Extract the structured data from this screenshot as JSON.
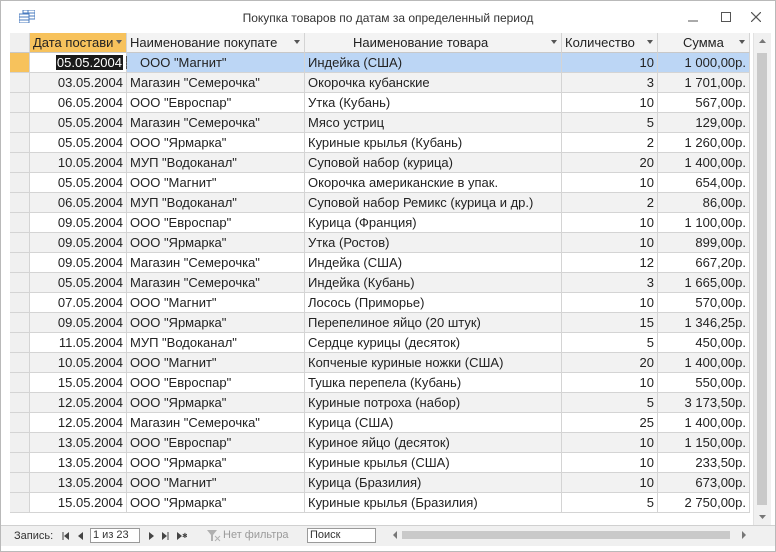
{
  "window": {
    "title": "Покупка товаров по датам за определенный период"
  },
  "columns": [
    {
      "label": "Дата постави",
      "active": true
    },
    {
      "label": "Наименование покупате",
      "active": false
    },
    {
      "label": "Наименование товара",
      "active": false
    },
    {
      "label": "Количество",
      "active": false
    },
    {
      "label": "Сумма",
      "active": false
    }
  ],
  "rows": [
    {
      "date": "05.05.2004",
      "buyer": "ООО \"Магнит\"",
      "product": "Индейка (США)",
      "qty": "10",
      "sum": "1 000,00р."
    },
    {
      "date": "03.05.2004",
      "buyer": "Магазин \"Семерочка\"",
      "product": "Окорочка кубанские",
      "qty": "3",
      "sum": "1 701,00р."
    },
    {
      "date": "06.05.2004",
      "buyer": "ООО \"Евроспар\"",
      "product": "Утка (Кубань)",
      "qty": "10",
      "sum": "567,00р."
    },
    {
      "date": "05.05.2004",
      "buyer": "Магазин \"Семерочка\"",
      "product": "Мясо устриц",
      "qty": "5",
      "sum": "129,00р."
    },
    {
      "date": "05.05.2004",
      "buyer": "ООО \"Ярмарка\"",
      "product": "Куриные крылья (Кубань)",
      "qty": "2",
      "sum": "1 260,00р."
    },
    {
      "date": "10.05.2004",
      "buyer": "МУП \"Водоканал\"",
      "product": "Суповой набор (курица)",
      "qty": "20",
      "sum": "1 400,00р."
    },
    {
      "date": "05.05.2004",
      "buyer": "ООО \"Магнит\"",
      "product": "Окорочка американские в упак.",
      "qty": "10",
      "sum": "654,00р."
    },
    {
      "date": "06.05.2004",
      "buyer": "МУП \"Водоканал\"",
      "product": "Суповой набор Ремикс (курица и др.)",
      "qty": "2",
      "sum": "86,00р."
    },
    {
      "date": "09.05.2004",
      "buyer": "ООО \"Евроспар\"",
      "product": "Курица (Франция)",
      "qty": "10",
      "sum": "1 100,00р."
    },
    {
      "date": "09.05.2004",
      "buyer": "ООО \"Ярмарка\"",
      "product": "Утка (Ростов)",
      "qty": "10",
      "sum": "899,00р."
    },
    {
      "date": "09.05.2004",
      "buyer": "Магазин \"Семерочка\"",
      "product": "Индейка (США)",
      "qty": "12",
      "sum": "667,20р."
    },
    {
      "date": "05.05.2004",
      "buyer": "Магазин \"Семерочка\"",
      "product": "Индейка (Кубань)",
      "qty": "3",
      "sum": "1 665,00р."
    },
    {
      "date": "07.05.2004",
      "buyer": "ООО \"Магнит\"",
      "product": "Лосось (Приморье)",
      "qty": "10",
      "sum": "570,00р."
    },
    {
      "date": "09.05.2004",
      "buyer": "ООО \"Ярмарка\"",
      "product": "Перепелиное яйцо (20 штук)",
      "qty": "15",
      "sum": "1 346,25р."
    },
    {
      "date": "11.05.2004",
      "buyer": "МУП \"Водоканал\"",
      "product": "Сердце курицы (десяток)",
      "qty": "5",
      "sum": "450,00р."
    },
    {
      "date": "10.05.2004",
      "buyer": "ООО \"Магнит\"",
      "product": "Копченые куриные ножки (США)",
      "qty": "20",
      "sum": "1 400,00р."
    },
    {
      "date": "15.05.2004",
      "buyer": "ООО \"Евроспар\"",
      "product": "Тушка перепела (Кубань)",
      "qty": "10",
      "sum": "550,00р."
    },
    {
      "date": "12.05.2004",
      "buyer": "ООО \"Ярмарка\"",
      "product": "Куриные потроха (набор)",
      "qty": "5",
      "sum": "3 173,50р."
    },
    {
      "date": "12.05.2004",
      "buyer": "Магазин \"Семерочка\"",
      "product": "Курица (США)",
      "qty": "25",
      "sum": "1 400,00р."
    },
    {
      "date": "13.05.2004",
      "buyer": "ООО \"Евроспар\"",
      "product": "Куриное яйцо (десяток)",
      "qty": "10",
      "sum": "1 150,00р."
    },
    {
      "date": "13.05.2004",
      "buyer": "ООО \"Ярмарка\"",
      "product": "Куриные крылья (США)",
      "qty": "10",
      "sum": "233,50р."
    },
    {
      "date": "13.05.2004",
      "buyer": "ООО \"Магнит\"",
      "product": "Курица (Бразилия)",
      "qty": "10",
      "sum": "673,00р."
    },
    {
      "date": "15.05.2004",
      "buyer": "ООО \"Ярмарка\"",
      "product": "Куриные крылья (Бразилия)",
      "qty": "5",
      "sum": "2 750,00р."
    }
  ],
  "new_row_marker": "✱",
  "nav": {
    "records_label": "Запись:",
    "position": "1 из 23",
    "filter_label": "Нет фильтра",
    "search_label": "Поиск"
  },
  "colors": {
    "active_header": "#f7c25c",
    "selected_row": "#bcd6f5",
    "alt_row": "#f2f2f2"
  }
}
